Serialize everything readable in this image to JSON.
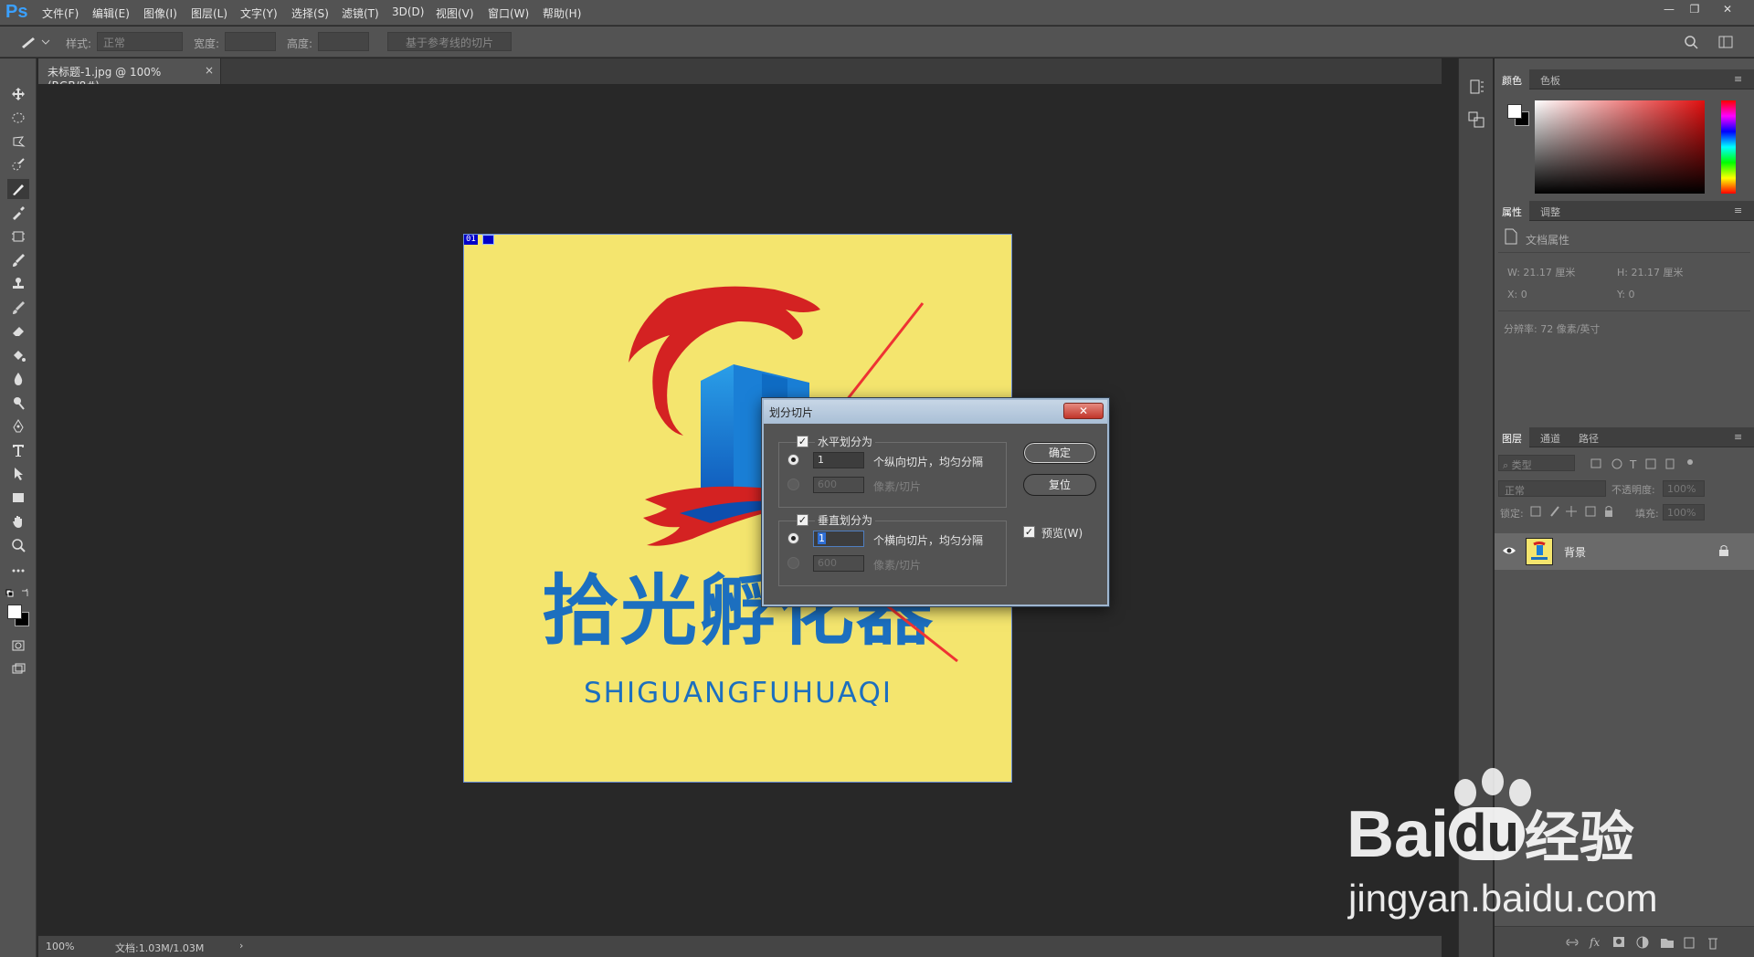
{
  "app": {
    "logo": "Ps"
  },
  "menu": [
    "文件(F)",
    "编辑(E)",
    "图像(I)",
    "图层(L)",
    "文字(Y)",
    "选择(S)",
    "滤镜(T)",
    "3D(D)",
    "视图(V)",
    "窗口(W)",
    "帮助(H)"
  ],
  "options": {
    "style_label": "样式:",
    "style_value": "正常",
    "width_label": "宽度:",
    "height_label": "高度:",
    "guides_button": "基于参考线的切片"
  },
  "document": {
    "tab_title": "未标题-1.jpg @ 100%(RGB/8#)",
    "slice_badge": "01",
    "logo_text_cn": "拾光孵化器",
    "logo_text_en": "SHIGUANGFUHUAQI"
  },
  "status": {
    "zoom": "100%",
    "doc_info": "文档:1.03M/1.03M"
  },
  "dialog": {
    "title": "划分切片",
    "horizontal": {
      "label": "水平划分为",
      "count": "1",
      "count_label": "个纵向切片，均匀分隔",
      "pixels": "600",
      "pixels_label": "像素/切片"
    },
    "vertical": {
      "label": "垂直划分为",
      "count": "1",
      "count_label": "个横向切片，均匀分隔",
      "pixels": "600",
      "pixels_label": "像素/切片"
    },
    "ok": "确定",
    "reset": "复位",
    "preview": "预览(W)"
  },
  "panels": {
    "color_tabs": [
      "颜色",
      "色板"
    ],
    "props_tabs": [
      "属性",
      "调整"
    ],
    "props_title": "文档属性",
    "props_w": "W:  21.17 厘米",
    "props_h": "H:  21.17 厘米",
    "props_x": "X:  0",
    "props_y": "Y:  0",
    "props_res": "分辨率: 72 像素/英寸",
    "layer_tabs": [
      "图层",
      "通道",
      "路径"
    ],
    "layer_filter": "类型",
    "blend_mode": "正常",
    "opacity_label": "不透明度:",
    "opacity_value": "100%",
    "lock_label": "锁定:",
    "fill_label": "填充:",
    "fill_value": "100%",
    "layer_name": "背景"
  },
  "watermark": {
    "brand": "Bai",
    "brand2": "du",
    "product": "经验",
    "url": "jingyan.baidu.com"
  },
  "colors": {
    "accent": "#1c6fbf",
    "canvas_bg": "#f4e56e",
    "logo_red": "#d42222"
  }
}
